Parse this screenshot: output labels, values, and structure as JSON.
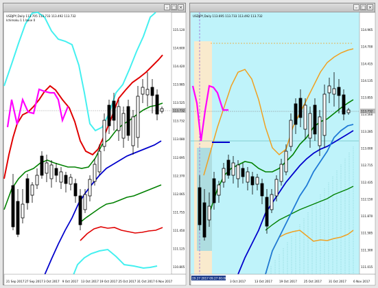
{
  "left_chart": {
    "header": "USDJPY,Daily  113.705 113.733 113.492 113.732",
    "indicator": "Ichimoku 1 1 base 0",
    "price_label": "113.732",
    "y_ticks": [
      "115.120",
      "114.600",
      "114.420",
      "113.985",
      "113.525",
      "113.732",
      "113.080",
      "112.695",
      "112.370",
      "112.065",
      "111.755",
      "111.450",
      "111.125",
      "110.805"
    ],
    "x_ticks": [
      "21 Sep 2017",
      "27 Sep 2017",
      "3 Oct 2017",
      "9 Oct 2017",
      "13 Oct 2017",
      "19 Oct 2017",
      "25 Oct 2017",
      "31 Oct 2017",
      "6 Nov 2017"
    ]
  },
  "right_chart": {
    "header": "USDJPY,Daily  113.695 113.733 113.492 113.732",
    "price_label": "113.732",
    "y_ticks": [
      "114.965",
      "114.700",
      "114.415",
      "114.135",
      "113.855",
      "113.560",
      "113.285",
      "113.000",
      "112.715",
      "112.435",
      "112.150",
      "111.870",
      "111.585",
      "111.300",
      "111.015"
    ],
    "x_ticks": [
      "3 Oct 2017",
      "13 Oct 2017",
      "19 Oct 2017",
      "25 Oct 2017",
      "31 Oct 2017",
      "6 Nov 2017"
    ],
    "date_highlight": "29.27 2017 09.27 00:00"
  },
  "colors": {
    "cyan": "#44f0f0",
    "red": "#e00000",
    "green": "#008000",
    "blue": "#0000cc",
    "magenta": "#ff00ff",
    "orange": "#f0a020",
    "cloud": "#bff3fa"
  }
}
